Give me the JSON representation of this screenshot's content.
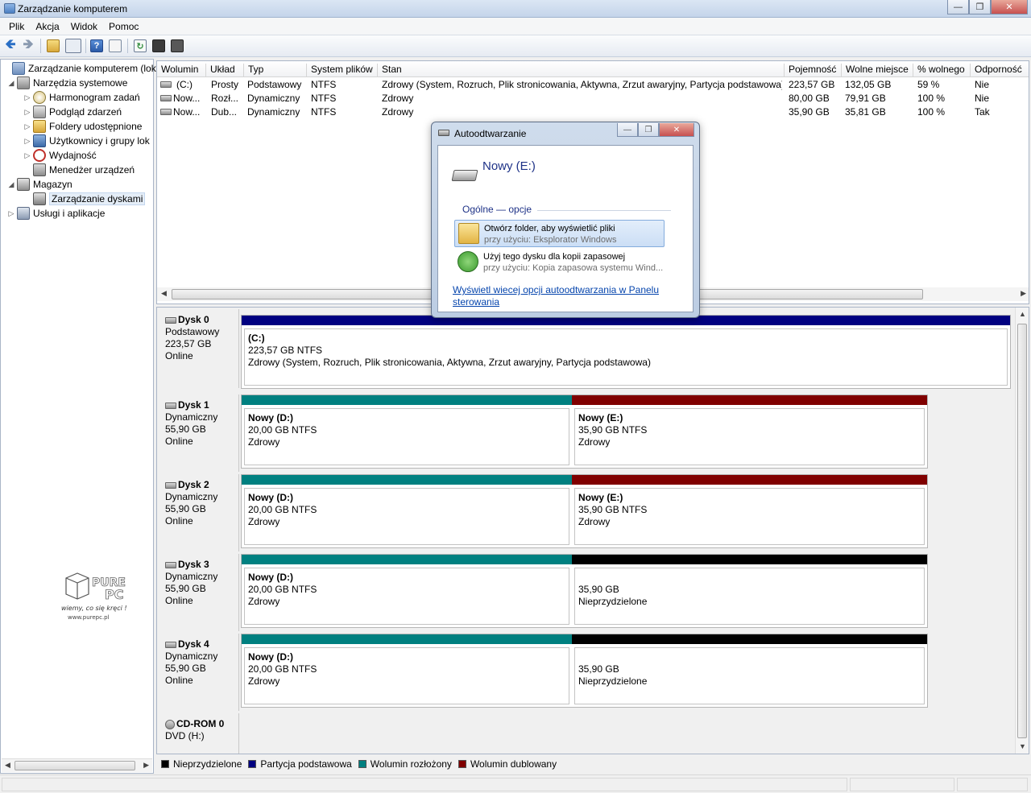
{
  "window": {
    "title": "Zarządzanie komputerem"
  },
  "menu": [
    "Plik",
    "Akcja",
    "Widok",
    "Pomoc"
  ],
  "tree": {
    "root": "Zarządzanie komputerem (loka",
    "system_tools": "Narzędzia systemowe",
    "task_scheduler": "Harmonogram zadań",
    "event_viewer": "Podgląd zdarzeń",
    "shared_folders": "Foldery udostępnione",
    "users_groups": "Użytkownicy i grupy lok",
    "performance": "Wydajność",
    "device_manager": "Menedżer urządzeń",
    "storage": "Magazyn",
    "disk_management": "Zarządzanie dyskami",
    "services_apps": "Usługi i aplikacje"
  },
  "volume_list": {
    "headers": [
      "Wolumin",
      "Układ",
      "Typ",
      "System plików",
      "Stan",
      "Pojemność",
      "Wolne miejsce",
      "% wolnego",
      "Odporność"
    ],
    "rows": [
      [
        "(C:)",
        "Prosty",
        "Podstawowy",
        "NTFS",
        "Zdrowy (System, Rozruch, Plik stronicowania, Aktywna, Zrzut awaryjny, Partycja podstawowa)",
        "223,57 GB",
        "132,05 GB",
        "59 %",
        "Nie"
      ],
      [
        "Now...",
        "Rozł...",
        "Dynamiczny",
        "NTFS",
        "Zdrowy",
        "80,00 GB",
        "79,91 GB",
        "100 %",
        "Nie"
      ],
      [
        "Now...",
        "Dub...",
        "Dynamiczny",
        "NTFS",
        "Zdrowy",
        "35,90 GB",
        "35,81 GB",
        "100 %",
        "Tak"
      ]
    ]
  },
  "disks": [
    {
      "name": "Dysk 0",
      "type": "Podstawowy",
      "size": "223,57 GB",
      "status": "Online",
      "parts": [
        {
          "name": "(C:)",
          "size": "223,57 GB NTFS",
          "state": "Zdrowy (System, Rozruch, Plik stronicowania, Aktywna, Zrzut awaryjny, Partycja podstawowa)",
          "color": "#000080"
        }
      ]
    },
    {
      "name": "Dysk 1",
      "type": "Dynamiczny",
      "size": "55,90 GB",
      "status": "Online",
      "parts": [
        {
          "name": "Nowy  (D:)",
          "size": "20,00 GB NTFS",
          "state": "Zdrowy",
          "color": "#008080"
        },
        {
          "name": "Nowy  (E:)",
          "size": "35,90 GB NTFS",
          "state": "Zdrowy",
          "color": "#800000"
        }
      ]
    },
    {
      "name": "Dysk 2",
      "type": "Dynamiczny",
      "size": "55,90 GB",
      "status": "Online",
      "parts": [
        {
          "name": "Nowy  (D:)",
          "size": "20,00 GB NTFS",
          "state": "Zdrowy",
          "color": "#008080"
        },
        {
          "name": "Nowy  (E:)",
          "size": "35,90 GB NTFS",
          "state": "Zdrowy",
          "color": "#800000"
        }
      ]
    },
    {
      "name": "Dysk 3",
      "type": "Dynamiczny",
      "size": "55,90 GB",
      "status": "Online",
      "parts": [
        {
          "name": "Nowy  (D:)",
          "size": "20,00 GB NTFS",
          "state": "Zdrowy",
          "color": "#008080"
        },
        {
          "name": "",
          "size": "35,90 GB",
          "state": "Nieprzydzielone",
          "color": "#000000"
        }
      ]
    },
    {
      "name": "Dysk 4",
      "type": "Dynamiczny",
      "size": "55,90 GB",
      "status": "Online",
      "parts": [
        {
          "name": "Nowy  (D:)",
          "size": "20,00 GB NTFS",
          "state": "Zdrowy",
          "color": "#008080"
        },
        {
          "name": "",
          "size": "35,90 GB",
          "state": "Nieprzydzielone",
          "color": "#000000"
        }
      ]
    }
  ],
  "cdrom": {
    "name": "CD-ROM 0",
    "type": "DVD (H:)"
  },
  "legend": [
    {
      "label": "Nieprzydzielone",
      "color": "#000000"
    },
    {
      "label": "Partycja podstawowa",
      "color": "#000080"
    },
    {
      "label": "Wolumin rozłożony",
      "color": "#008080"
    },
    {
      "label": "Wolumin dublowany",
      "color": "#800000"
    }
  ],
  "autoplay": {
    "title": "Autoodtwarzanie",
    "drive": "Nowy (E:)",
    "group": "Ogólne — opcje",
    "option1_title": "Otwórz folder, aby wyświetlić pliki",
    "option1_sub": "przy użyciu: Eksplorator Windows",
    "option2_title": "Użyj tego dysku dla kopii zapasowej",
    "option2_sub": "przy użyciu: Kopia zapasowa systemu Wind...",
    "link": "Wyświetl wiecej opcji autoodtwarzania w Panelu sterowania"
  },
  "watermark": {
    "brand": "PURE PC",
    "slogan": "wiemy, co się kręci !",
    "url": "www.purepc.pl"
  }
}
